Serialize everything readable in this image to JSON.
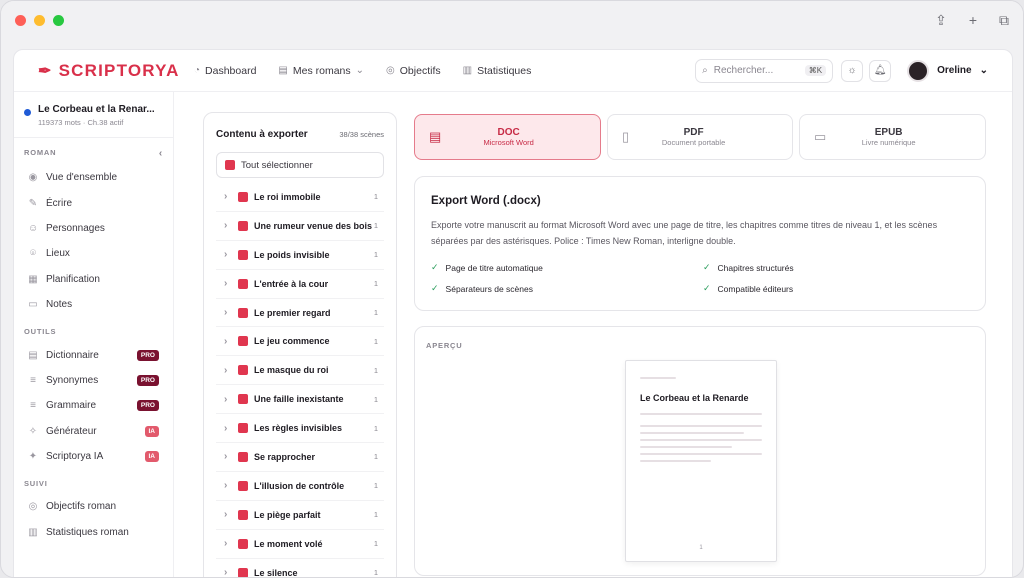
{
  "window": {
    "toolbar_icons": [
      "share-icon",
      "plus-icon",
      "copy-icon"
    ]
  },
  "brand": {
    "name": "SCRIPTORYA",
    "accent": "#d9304a"
  },
  "nav": {
    "items": [
      {
        "label": "Dashboard",
        "icon": "dashboard-icon"
      },
      {
        "label": "Mes romans",
        "icon": "book-icon"
      },
      {
        "label": "Objectifs",
        "icon": "target-icon"
      },
      {
        "label": "Statistiques",
        "icon": "chart-icon"
      }
    ]
  },
  "search": {
    "placeholder": "Rechercher...",
    "shortcut": "⌘K"
  },
  "user": {
    "name": "Oreline"
  },
  "project": {
    "title": "Le Corbeau et la Renar...",
    "meta": "119373 mots · Ch.38 actif"
  },
  "sidebar": {
    "sections": [
      {
        "title": "ROMAN",
        "items": [
          {
            "label": "Vue d'ensemble",
            "icon": "eye-icon"
          },
          {
            "label": "Écrire",
            "icon": "pencil-icon"
          },
          {
            "label": "Personnages",
            "icon": "people-icon"
          },
          {
            "label": "Lieux",
            "icon": "pin-icon"
          },
          {
            "label": "Planification",
            "icon": "calendar-icon"
          },
          {
            "label": "Notes",
            "icon": "note-icon"
          }
        ]
      },
      {
        "title": "OUTILS",
        "items": [
          {
            "label": "Dictionnaire",
            "icon": "book-icon",
            "badge": "PRO"
          },
          {
            "label": "Synonymes",
            "icon": "list-icon",
            "badge": "PRO"
          },
          {
            "label": "Grammaire",
            "icon": "list-icon",
            "badge": "PRO"
          },
          {
            "label": "Générateur",
            "icon": "wand-icon",
            "badge": "IA"
          },
          {
            "label": "Scriptorya IA",
            "icon": "sparkle-icon",
            "badge": "IA"
          }
        ]
      },
      {
        "title": "SUIVI",
        "items": [
          {
            "label": "Objectifs roman",
            "icon": "target-icon"
          },
          {
            "label": "Statistiques roman",
            "icon": "chart-icon"
          }
        ]
      }
    ]
  },
  "export": {
    "title": "Contenu à exporter",
    "count": "38/38 scènes",
    "select_all": "Tout sélectionner",
    "scenes": [
      {
        "title": "Le roi immobile",
        "n": "1"
      },
      {
        "title": "Une rumeur venue des bois",
        "n": "1"
      },
      {
        "title": "Le poids invisible",
        "n": "1"
      },
      {
        "title": "L'entrée à la cour",
        "n": "1"
      },
      {
        "title": "Le premier regard",
        "n": "1"
      },
      {
        "title": "Le jeu commence",
        "n": "1"
      },
      {
        "title": "Le masque du roi",
        "n": "1"
      },
      {
        "title": "Une faille inexistante",
        "n": "1"
      },
      {
        "title": "Les règles invisibles",
        "n": "1"
      },
      {
        "title": "Se rapprocher",
        "n": "1"
      },
      {
        "title": "L'illusion de contrôle",
        "n": "1"
      },
      {
        "title": "Le piège parfait",
        "n": "1"
      },
      {
        "title": "Le moment volé",
        "n": "1"
      },
      {
        "title": "Le silence",
        "n": "1"
      }
    ]
  },
  "formats": [
    {
      "name": "DOC",
      "sub": "Microsoft Word",
      "icon": "doc-icon",
      "active": true
    },
    {
      "name": "PDF",
      "sub": "Document portable",
      "icon": "file-icon",
      "active": false
    },
    {
      "name": "EPUB",
      "sub": "Livre numérique",
      "icon": "book-icon",
      "active": false
    }
  ],
  "info": {
    "title": "Export Word (.docx)",
    "desc": "Exporte votre manuscrit au format Microsoft Word avec une page de titre, les chapitres comme titres de niveau 1, et les scènes séparées par des astérisques. Police : Times New Roman, interligne double.",
    "features": [
      "Page de titre automatique",
      "Chapitres structurés",
      "Séparateurs de scènes",
      "Compatible éditeurs"
    ]
  },
  "preview": {
    "label": "APERÇU",
    "page_title": "Le Corbeau et la Renarde",
    "page_number": "1"
  }
}
